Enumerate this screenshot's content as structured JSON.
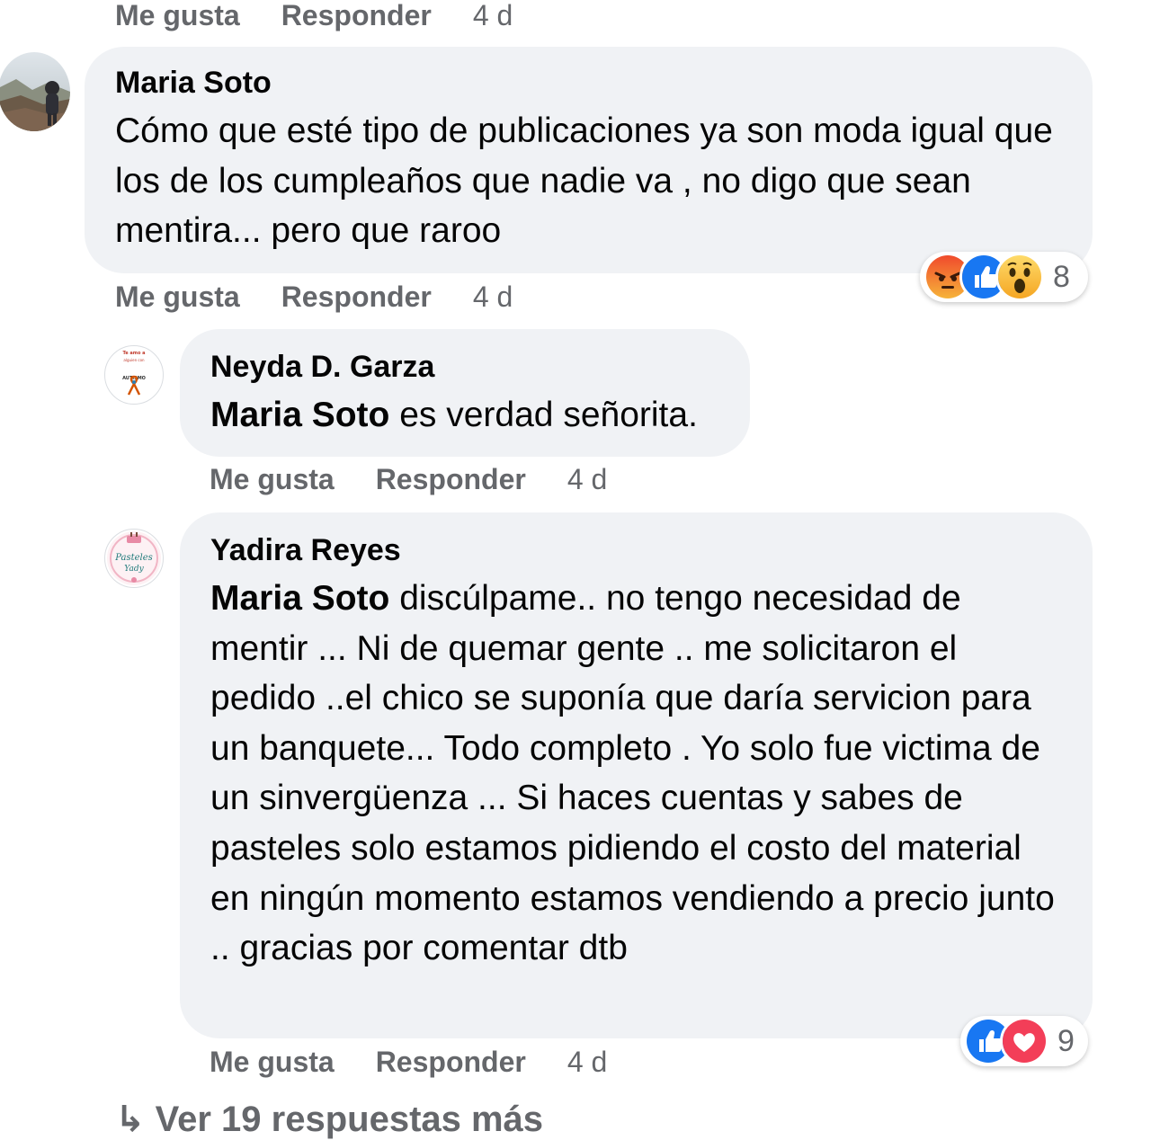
{
  "top_actions": {
    "like": "Me gusta",
    "reply": "Responder",
    "time": "4 d"
  },
  "comments": [
    {
      "author": "Maria Soto",
      "text": "Cómo que esté tipo de publicaciones ya son moda igual que los de los cumpleaños que nadie va , no digo que sean mentira... pero que raroo",
      "reactions": {
        "icons": [
          "angry-icon",
          "like-icon",
          "wow-icon"
        ],
        "count": "8"
      },
      "actions": {
        "like": "Me gusta",
        "reply": "Responder",
        "time": "4 d"
      }
    }
  ],
  "replies": [
    {
      "author": "Neyda D. Garza",
      "mention": "Maria Soto",
      "text": " es verdad señorita.",
      "avatar_text": {
        "line1": "Te amo a",
        "line2": "alguien con",
        "line3": "AUTISMO"
      },
      "actions": {
        "like": "Me gusta",
        "reply": "Responder",
        "time": "4 d"
      }
    },
    {
      "author": "Yadira Reyes",
      "mention": "Maria Soto",
      "text": " discúlpame.. no tengo necesidad de mentir ... Ni de quemar gente .. me solicitaron el pedido ..el chico se suponía que daría servicion para un banquete... Todo completo . Yo solo fue victima de un sinvergüenza ... Si haces cuentas y sabes de pasteles solo estamos pidiendo el costo del material en ningún momento estamos vendiendo a precio junto .. gracias por comentar dtb",
      "avatar_text": {
        "line1": "Pasteles",
        "line2": "Yady"
      },
      "reactions": {
        "icons": [
          "like-icon",
          "love-icon"
        ],
        "count": "9"
      },
      "actions": {
        "like": "Me gusta",
        "reply": "Responder",
        "time": "4 d"
      }
    }
  ],
  "more_replies": "Ver 19 respuestas más",
  "colors": {
    "bubble": "#f0f2f5",
    "muted": "#65676b",
    "like": "#1877f2",
    "love": "#f33e58",
    "angry": "#e9710f",
    "wow": "#f7b125"
  }
}
